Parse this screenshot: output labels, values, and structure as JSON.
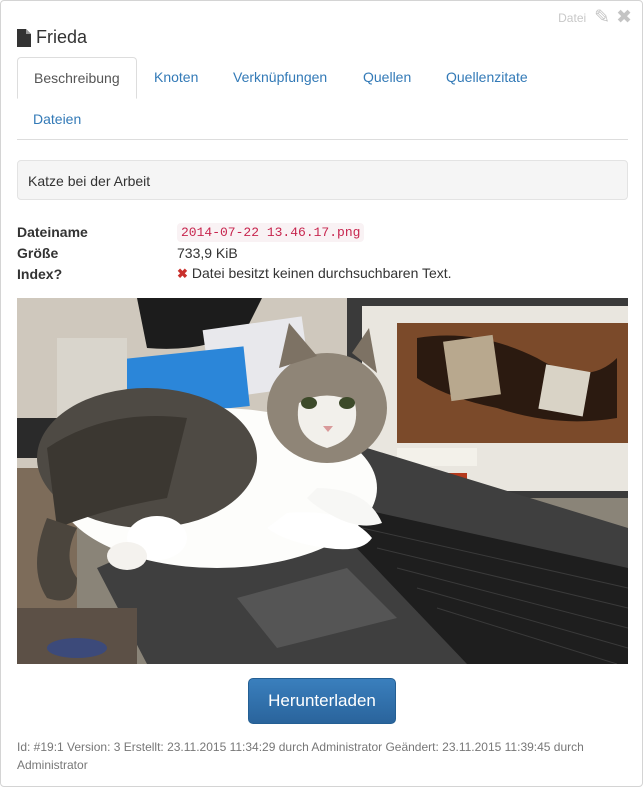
{
  "header": {
    "type_label": "Datei",
    "title": "Frieda"
  },
  "tabs": [
    {
      "label": "Beschreibung",
      "active": true
    },
    {
      "label": "Knoten"
    },
    {
      "label": "Verknüpfungen"
    },
    {
      "label": "Quellen"
    },
    {
      "label": "Quellenzitate"
    },
    {
      "label": "Dateien"
    }
  ],
  "description": "Katze bei der Arbeit",
  "meta": {
    "filename_label": "Dateiname",
    "filename_value": "2014-07-22 13.46.17.png",
    "size_label": "Größe",
    "size_value": "733,9 KiB",
    "index_label": "Index?",
    "index_value": "Datei besitzt keinen durchsuchbaren Text."
  },
  "download_button": "Herunterladen",
  "footer": "Id: #19:1 Version: 3 Erstellt: 23.11.2015 11:34:29 durch Administrator Geändert: 23.11.2015 11:39:45 durch Administrator",
  "colors": {
    "link": "#337ab7",
    "button": "#2d6ea8",
    "error_icon": "#c9302c",
    "code_text": "#c7254e"
  },
  "icons": {
    "edit": "pencil-icon",
    "close": "close-icon",
    "title": "file-icon",
    "index_status": "cross-icon"
  }
}
